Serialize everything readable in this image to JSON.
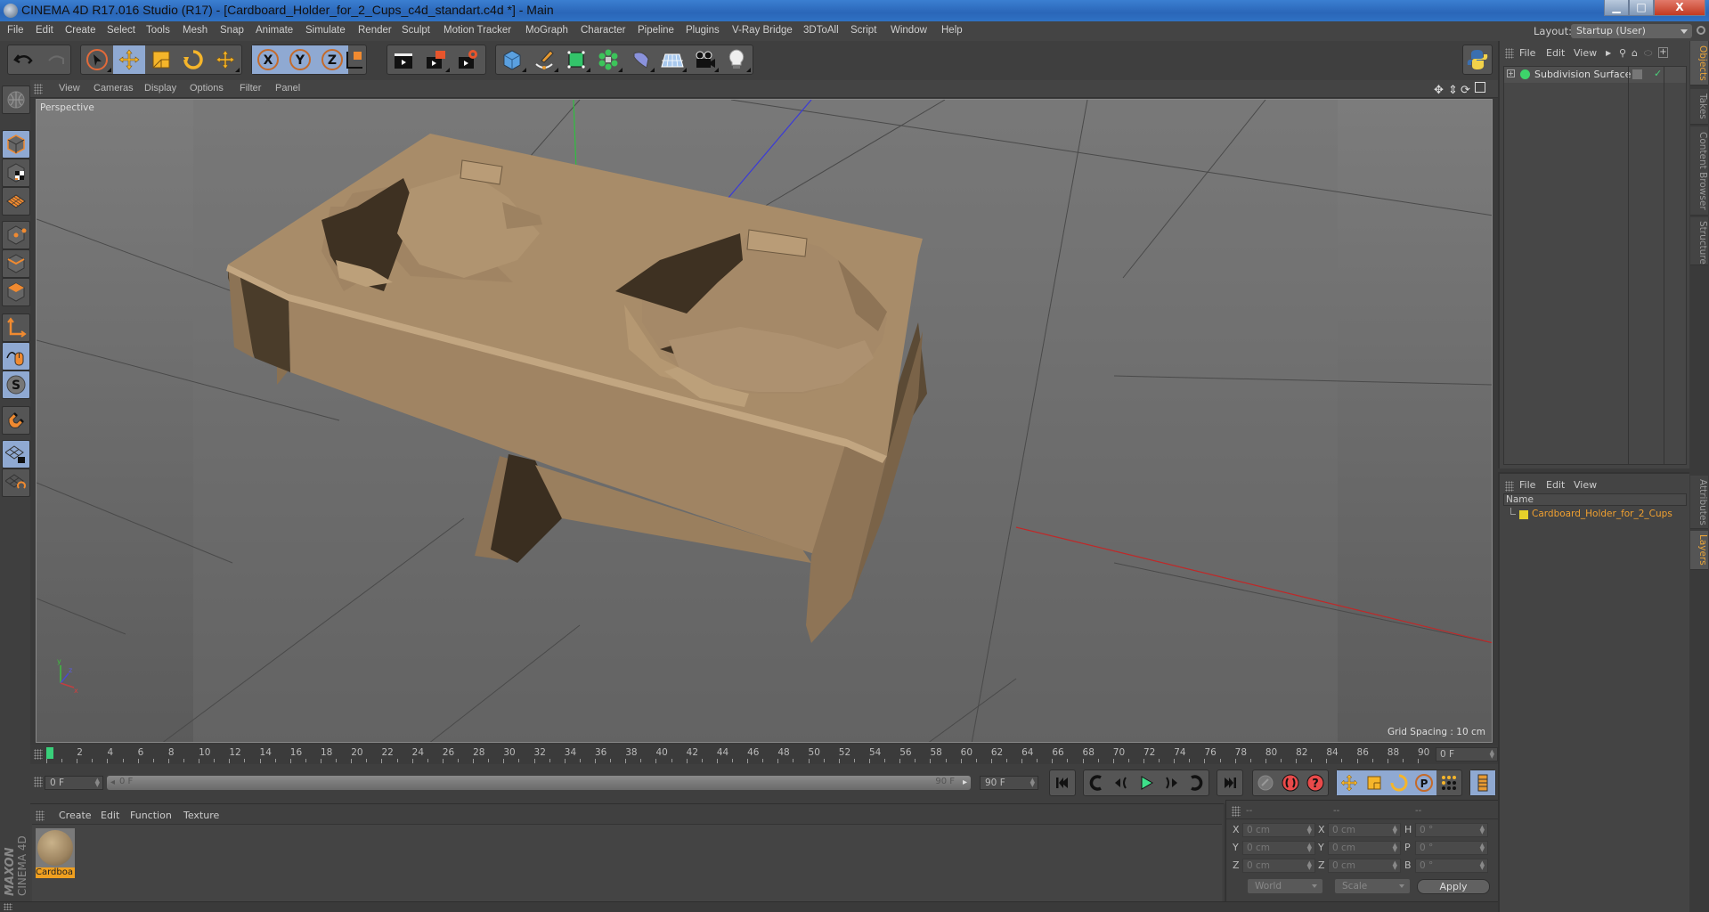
{
  "window": {
    "title": "CINEMA 4D R17.016 Studio (R17) - [Cardboard_Holder_for_2_Cups_c4d_standart.c4d *] - Main",
    "controls": {
      "minimize": "▁",
      "maximize": "□",
      "close": "X"
    }
  },
  "menubar": {
    "items": [
      "File",
      "Edit",
      "Create",
      "Select",
      "Tools",
      "Mesh",
      "Snap",
      "Animate",
      "Simulate",
      "Render",
      "Sculpt",
      "Motion Tracker",
      "MoGraph",
      "Character",
      "Pipeline",
      "Plugins",
      "V-Ray Bridge",
      "3DToAll",
      "Script",
      "Window",
      "Help"
    ],
    "layout_label": "Layout:",
    "layout_value": "Startup (User)"
  },
  "toolbar": {
    "buttons": [
      {
        "name": "undo-icon"
      },
      {
        "name": "redo-icon"
      },
      {
        "name": "live-selection-icon"
      },
      {
        "name": "move-icon",
        "active": true
      },
      {
        "name": "scale-icon"
      },
      {
        "name": "rotate-icon"
      },
      {
        "name": "recent-tool-icon"
      },
      {
        "name": "x-axis-lock-icon",
        "label": "X",
        "active": true
      },
      {
        "name": "y-axis-lock-icon",
        "label": "Y",
        "active": true
      },
      {
        "name": "z-axis-lock-icon",
        "label": "Z",
        "active": true
      },
      {
        "name": "coordinate-system-icon"
      },
      {
        "name": "render-view-icon"
      },
      {
        "name": "render-picture-viewer-icon"
      },
      {
        "name": "render-settings-icon"
      },
      {
        "name": "cube-icon"
      },
      {
        "name": "pen-spline-icon"
      },
      {
        "name": "subdivision-surface-icon"
      },
      {
        "name": "cloner-icon"
      },
      {
        "name": "deformer-icon"
      },
      {
        "name": "floor-icon"
      },
      {
        "name": "camera-icon"
      },
      {
        "name": "light-icon"
      }
    ]
  },
  "left_tools": [
    {
      "name": "make-editable-icon"
    },
    {
      "name": "model-mode-icon",
      "active": true
    },
    {
      "name": "texture-mode-icon"
    },
    {
      "name": "workplane-mode-icon"
    },
    {
      "name": "points-mode-icon"
    },
    {
      "name": "edges-mode-icon"
    },
    {
      "name": "polygons-mode-icon"
    },
    {
      "name": "axis-mode-icon"
    },
    {
      "name": "tweak-mode-icon",
      "active": true
    },
    {
      "name": "solo-icon",
      "label": "S",
      "active": true
    },
    {
      "name": "snap-magnet-icon"
    },
    {
      "name": "workplane-lock-icon",
      "active": true
    },
    {
      "name": "workplane-align-icon"
    }
  ],
  "viewport": {
    "menu": [
      "View",
      "Cameras",
      "Display",
      "Options",
      "Filter",
      "Panel"
    ],
    "camera_label": "Perspective",
    "grid_spacing": "Grid Spacing : 10 cm",
    "nav_icons": [
      "move-view-icon",
      "zoom-view-icon",
      "rotate-view-icon",
      "maximize-view-icon"
    ],
    "model_color": "#a08463",
    "axis_gizmo": {
      "x": "x",
      "y": "y",
      "z": "z"
    }
  },
  "objects_panel": {
    "menu": [
      "File",
      "Edit",
      "View"
    ],
    "items": [
      {
        "label": "Subdivision Surface",
        "icon": "subdivision-surface-icon",
        "enabled": true
      }
    ]
  },
  "layers_panel": {
    "menu": [
      "File",
      "Edit",
      "View"
    ],
    "column_header": "Name",
    "items": [
      {
        "label": "Cardboard_Holder_for_2_Cups",
        "color": "#e6d12a"
      }
    ]
  },
  "right_tabs": {
    "top": [
      {
        "label": "Objects",
        "active": true
      },
      {
        "label": "Takes"
      },
      {
        "label": "Content Browser"
      },
      {
        "label": "Structure"
      }
    ],
    "bottom": [
      {
        "label": "Attributes"
      },
      {
        "label": "Layers",
        "active": true
      }
    ]
  },
  "timeline": {
    "start": 0,
    "end": 90,
    "step": 2,
    "current_frame": 0,
    "current_frame_display": "0 F"
  },
  "transport": {
    "start_field": "0 F",
    "range_start": "0 F",
    "range_end": "90 F",
    "end_field": "90 F",
    "buttons": [
      "go-to-start-icon",
      "previous-key-icon",
      "previous-frame-icon",
      "play-icon",
      "next-frame-icon",
      "next-key-icon",
      "go-to-end-icon",
      "motion-record-icon",
      "record-keys-icon",
      "autokey-icon",
      "key-position-icon",
      "key-scale-icon",
      "key-rotation-icon",
      "key-param-icon",
      "key-pla-icon",
      "timeline-icon"
    ]
  },
  "material_panel": {
    "menu": [
      "Create",
      "Edit",
      "Function",
      "Texture"
    ],
    "materials": [
      {
        "label": "Cardboa"
      }
    ]
  },
  "brand": {
    "top": "MAXON",
    "bottom": "CINEMA 4D"
  },
  "coordinates": {
    "headers": [
      "--",
      "--",
      "--"
    ],
    "rows": [
      {
        "pos_axis": "X",
        "pos": "0 cm",
        "size_axis": "X",
        "size": "0 cm",
        "rot_axis": "H",
        "rot": "0 °"
      },
      {
        "pos_axis": "Y",
        "pos": "0 cm",
        "size_axis": "Y",
        "size": "0 cm",
        "rot_axis": "P",
        "rot": "0 °"
      },
      {
        "pos_axis": "Z",
        "pos": "0 cm",
        "size_axis": "Z",
        "size": "0 cm",
        "rot_axis": "B",
        "rot": "0 °"
      }
    ],
    "space_select": "World",
    "mode_select": "Scale",
    "apply_label": "Apply"
  }
}
